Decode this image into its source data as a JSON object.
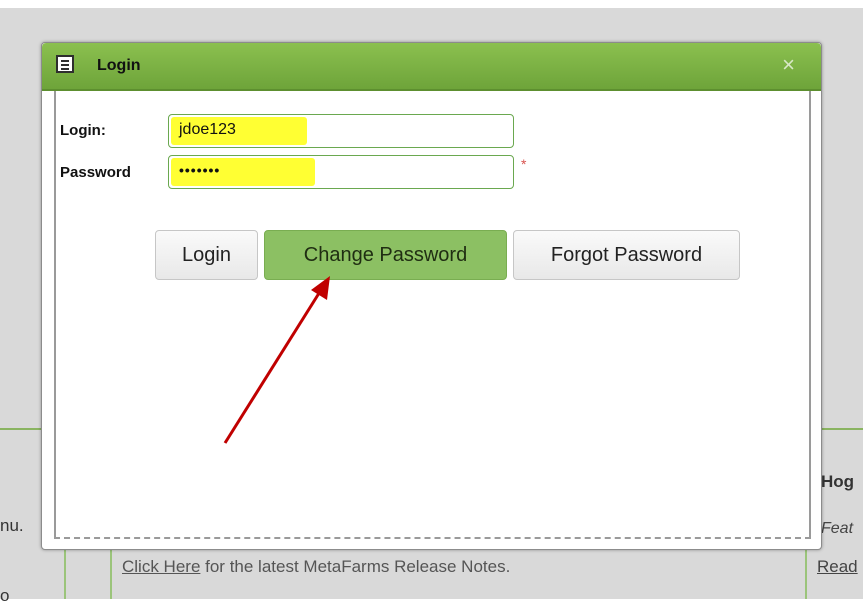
{
  "dialog": {
    "title": "Login",
    "close_glyph": "×"
  },
  "form": {
    "login_label": "Login:",
    "login_value": "jdoe123",
    "password_label": "Password",
    "password_masked": "•••••••",
    "required_marker": "*"
  },
  "buttons": {
    "login": "Login",
    "change_password": "Change Password",
    "forgot_password": "Forgot Password"
  },
  "background": {
    "left_fragment": "nu.",
    "left_fragment2": "o",
    "right_heading": "Hog",
    "right_italic": "Feat",
    "right_link": "Read",
    "release_link": "Click Here",
    "release_text": " for the latest MetaFarms Release Notes."
  },
  "colors": {
    "accent_green": "#7ab447",
    "highlight": "#ffff33",
    "annotation_arrow": "#c00000"
  },
  "icons": {
    "title": "window-icon",
    "close": "close-icon"
  }
}
